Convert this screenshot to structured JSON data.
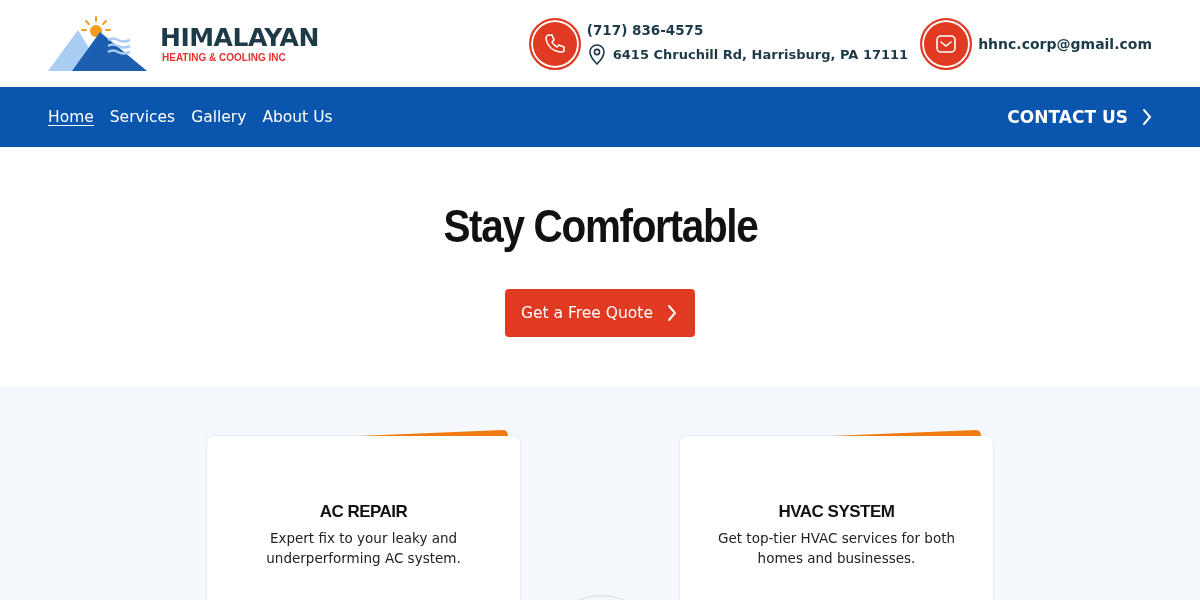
{
  "header": {
    "logo": {
      "name": "HIMALAYAN",
      "tagline": "HEATING & COOLING INC"
    },
    "phone": "(717) 836-4575",
    "address": "6415 Chruchill Rd, Harrisburg, PA 17111",
    "email": "hhnc.corp@gmail.com"
  },
  "nav": {
    "items": [
      {
        "label": "Home",
        "selected": true
      },
      {
        "label": "Services",
        "selected": false
      },
      {
        "label": "Gallery",
        "selected": false
      },
      {
        "label": "About Us",
        "selected": false
      }
    ],
    "cta": "CONTACT US"
  },
  "hero": {
    "title": "Stay Comfortable",
    "button": "Get a Free Quote"
  },
  "services": [
    {
      "title": "AC REPAIR",
      "text": "Expert fix to your leaky and underperforming AC system."
    },
    {
      "title": "HVAC SYSTEM",
      "text": "Get top-tier HVAC services for both homes and businesses."
    }
  ]
}
